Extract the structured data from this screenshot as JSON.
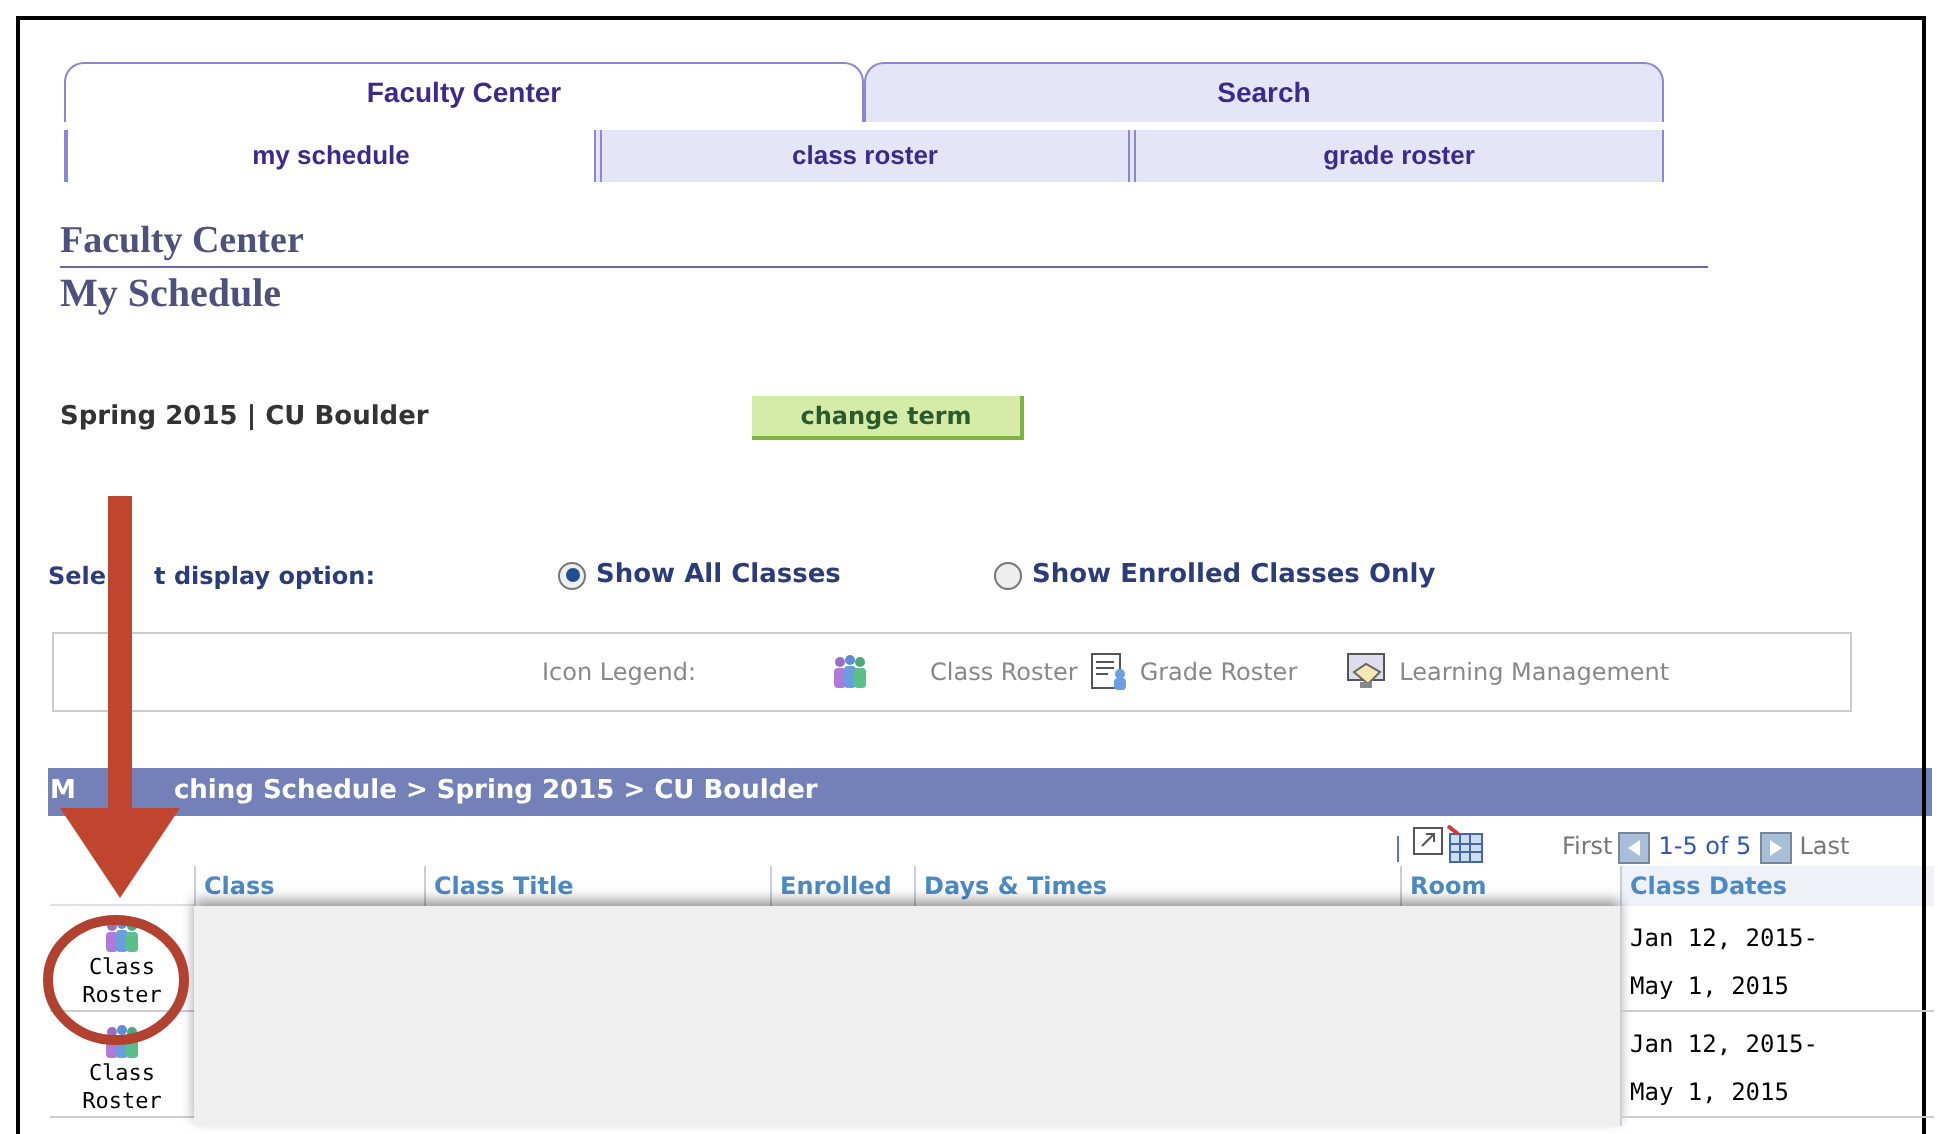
{
  "tabs": [
    {
      "label": "Faculty Center",
      "selected": true
    },
    {
      "label": "Search",
      "selected": false
    }
  ],
  "subtabs": [
    {
      "label": "my schedule",
      "selected": true
    },
    {
      "label": "class roster",
      "selected": false
    },
    {
      "label": "grade roster",
      "selected": false
    }
  ],
  "page_title": "Faculty Center",
  "subtitle": "My Schedule",
  "term": "Spring 2015 | CU Boulder",
  "change_term_button": "change term",
  "display_option": {
    "label_parts": [
      "Sele",
      "t display option:"
    ],
    "options": [
      {
        "label": "Show All Classes",
        "selected": true
      },
      {
        "label": "Show Enrolled Classes Only",
        "selected": false
      }
    ]
  },
  "icon_legend": {
    "label": "Icon Legend:",
    "items": [
      {
        "kind": "class-roster",
        "label": "Class Roster"
      },
      {
        "kind": "grade-roster",
        "label": "Grade Roster"
      },
      {
        "kind": "learning",
        "label": "Learning Management"
      }
    ]
  },
  "schedule": {
    "title_parts": [
      "M",
      "ching Schedule > Spring 2015 > CU Boulder"
    ],
    "pager": {
      "first": "First",
      "range": "1-5 of 5",
      "last": "Last"
    },
    "columns": [
      "Class",
      "Class Title",
      "Enrolled",
      "Days & Times",
      "Room",
      "Class Dates"
    ],
    "rows": [
      {
        "action": "Class Roster",
        "class_dates": "Jan 12, 2015-\nMay 1, 2015"
      },
      {
        "action": "Class Roster",
        "class_dates": "Jan 12, 2015-\nMay 1, 2015"
      }
    ]
  }
}
